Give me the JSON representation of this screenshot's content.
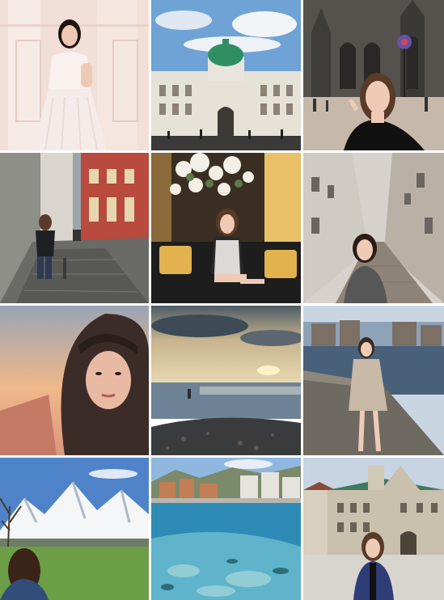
{
  "grid": {
    "columns": 3,
    "rows": 4,
    "background": "#ffffff",
    "tiles": [
      {
        "name": "tile-portrait-white-dress",
        "subject": "portrait",
        "palette": [
          "#f3e1da",
          "#f8eeea",
          "#1f1613"
        ]
      },
      {
        "name": "tile-palace-green-dome",
        "subject": "architecture",
        "palette": [
          "#6fa3d6",
          "#e6e2d8",
          "#2f8f62"
        ]
      },
      {
        "name": "tile-gothic-cathedral-selfie",
        "subject": "architecture-portrait",
        "palette": [
          "#4c4a46",
          "#c7b9aa",
          "#111111"
        ]
      },
      {
        "name": "tile-cobblestone-street",
        "subject": "street",
        "palette": [
          "#9aa6ad",
          "#b84a3e",
          "#3a3a3a"
        ]
      },
      {
        "name": "tile-lounge-flowers",
        "subject": "interior-portrait",
        "palette": [
          "#3a2e22",
          "#e9c067",
          "#1d1d1d"
        ]
      },
      {
        "name": "tile-narrow-alley",
        "subject": "street-portrait",
        "palette": [
          "#cfcac2",
          "#8e8378",
          "#575757"
        ]
      },
      {
        "name": "tile-hooded-selfie",
        "subject": "portrait",
        "palette": [
          "#f0b88a",
          "#3c2c28",
          "#d9977e"
        ]
      },
      {
        "name": "tile-sunset-sea",
        "subject": "landscape",
        "palette": [
          "#c7b48e",
          "#6f8396",
          "#3a3b3c"
        ]
      },
      {
        "name": "tile-riverside-pose",
        "subject": "city-portrait",
        "palette": [
          "#8fb0cb",
          "#c9b9a7",
          "#48607a"
        ]
      },
      {
        "name": "tile-snowy-mountains",
        "subject": "landscape-portrait",
        "palette": [
          "#4f83c9",
          "#f4f6f8",
          "#6b9e47"
        ]
      },
      {
        "name": "tile-turquoise-lake",
        "subject": "cityscape",
        "palette": [
          "#2e8bb5",
          "#9fd4d9",
          "#c27d55"
        ]
      },
      {
        "name": "tile-baroque-square",
        "subject": "architecture-portrait",
        "palette": [
          "#c9c0ad",
          "#3e7a60",
          "#2f3d77"
        ]
      }
    ]
  }
}
